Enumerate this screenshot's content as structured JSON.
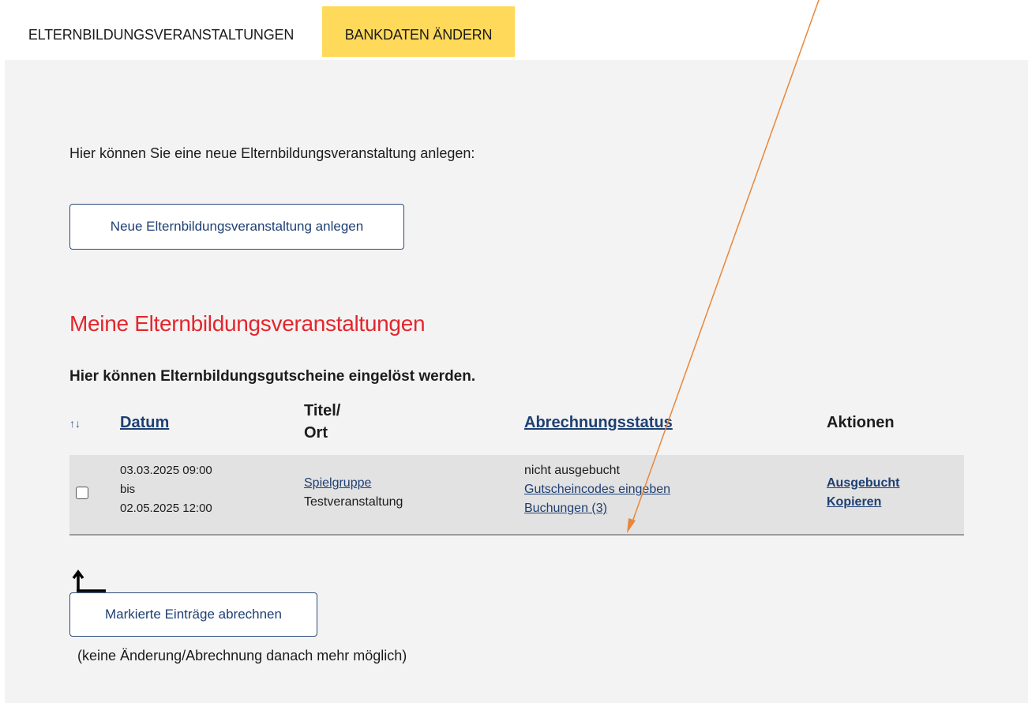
{
  "tabs": {
    "active": "ELTERNBILDUNGSVERANSTALTUNGEN",
    "bank": "BANKDATEN ÄNDERN",
    "bank_color": "#ffd95a"
  },
  "intro_text": "Hier können Sie eine neue Elternbildungsveranstaltung anlegen:",
  "new_button_label": "Neue Elternbildungsveranstaltung anlegen",
  "section_heading": "Meine Elternbildungsveranstaltungen",
  "heading_color": "#e3262d",
  "subheading": "Hier können Elternbildungsgutscheine eingelöst werden.",
  "table": {
    "sort_icon": "↑↓",
    "headers": {
      "datum": "Datum",
      "titel_line1": "Titel/",
      "titel_line2": "Ort",
      "abrechnungsstatus": "Abrechnungsstatus",
      "aktionen": "Aktionen"
    },
    "rows": [
      {
        "date_from": "03.03.2025 09:00",
        "bis": "bis",
        "date_to": "02.05.2025 12:00",
        "title": "Spielgruppe",
        "location": "Testveranstaltung",
        "status": "nicht ausgebucht",
        "status_link_codes": "Gutscheincodes eingeben",
        "status_link_bookings": "Buchungen (3)",
        "action_booked": "Ausgebucht",
        "action_copy": "Kopieren"
      }
    ]
  },
  "settle_button_label": "Markierte Einträge abrechnen",
  "settle_note": "(keine Änderung/Abrechnung danach mehr möglich)",
  "annotation_color": "#e8873a"
}
